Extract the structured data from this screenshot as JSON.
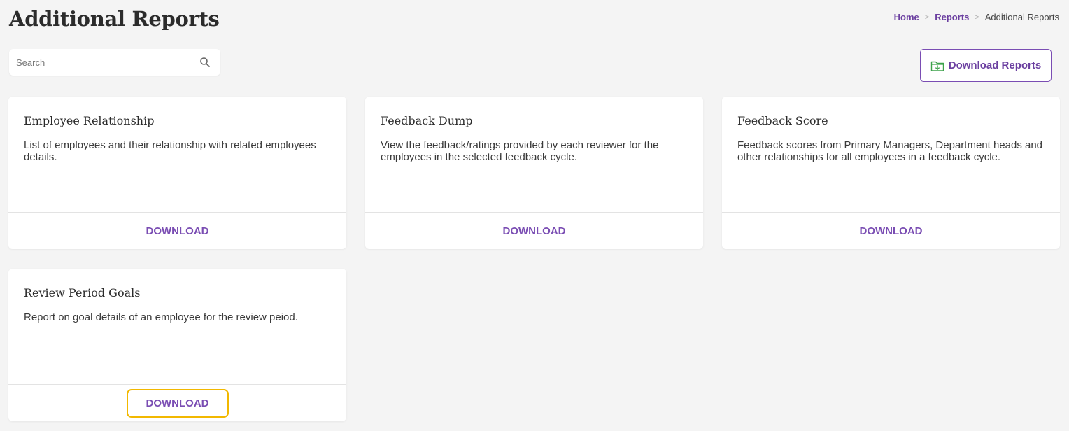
{
  "page": {
    "title": "Additional Reports"
  },
  "breadcrumb": {
    "home": "Home",
    "reports": "Reports",
    "current": "Additional Reports"
  },
  "search": {
    "placeholder": "Search",
    "value": ""
  },
  "toolbar": {
    "download_reports_label": "Download Reports"
  },
  "cards": [
    {
      "title": "Employee Relationship",
      "description": "List of employees and their relationship with related employees details.",
      "action": "DOWNLOAD"
    },
    {
      "title": "Feedback Dump",
      "description": "View the feedback/ratings provided by each reviewer for the employees in the selected feedback cycle.",
      "action": "DOWNLOAD"
    },
    {
      "title": "Feedback Score",
      "description": "Feedback scores from Primary Managers, Department heads and other relationships for all employees in a feedback cycle.",
      "action": "DOWNLOAD"
    },
    {
      "title": "Review Period Goals",
      "description": "Report on goal details of an employee for the review peiod.",
      "action": "DOWNLOAD"
    }
  ],
  "colors": {
    "accent": "#7a4db3",
    "focus": "#f2b800",
    "folder_icon": "#3ca24a"
  },
  "icons": {
    "search": "search-icon",
    "download_reports": "folder-download-icon"
  }
}
